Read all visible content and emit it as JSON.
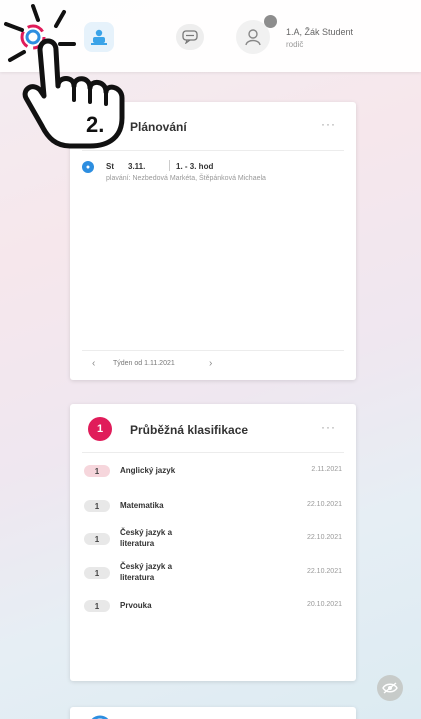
{
  "topbar": {
    "user_name": "1.A, Žák Student",
    "user_role": "rodič"
  },
  "plan_card": {
    "title": "Plánování",
    "more": "···",
    "entry": {
      "day": "St",
      "date": "3.11.",
      "hours": "1. - 3. hod",
      "description": "plavání: Nezbedová Markéta, Štěpánková Michaela"
    },
    "week_label": "Týden od 1.11.2021"
  },
  "grades_card": {
    "badge": "1",
    "title": "Průběžná klasifikace",
    "more": "···",
    "rows": [
      {
        "grade": "1",
        "subject": "Anglický jazyk",
        "date": "2.11.2021",
        "highlight": true
      },
      {
        "grade": "1",
        "subject": "Matematika",
        "date": "22.10.2021",
        "highlight": false
      },
      {
        "grade": "1",
        "subject": "Český jazyk a literatura",
        "date": "22.10.2021",
        "highlight": false
      },
      {
        "grade": "1",
        "subject": "Český jazyk a literatura",
        "date": "22.10.2021",
        "highlight": false
      },
      {
        "grade": "1",
        "subject": "Prvouka",
        "date": "20.10.2021",
        "highlight": false
      }
    ]
  },
  "overlay": {
    "step_label": "2."
  },
  "colors": {
    "accent_blue": "#2d8ee0",
    "grade_badge": "#e01c5a",
    "grade_highlight": "#f6d6dc",
    "grade_normal": "#e8e8e8"
  }
}
